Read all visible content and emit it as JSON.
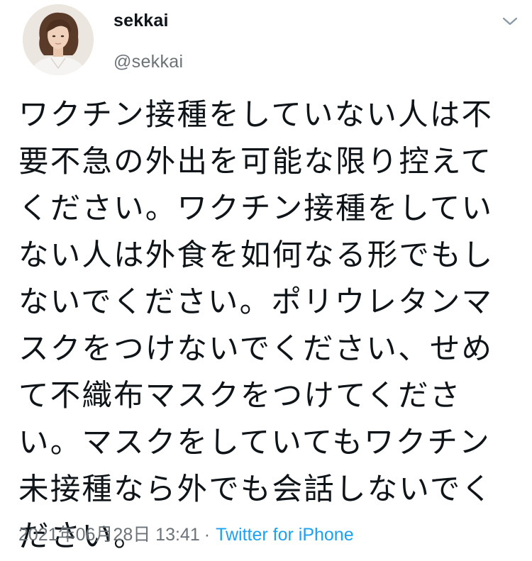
{
  "tweet": {
    "display_name": "sekkai",
    "handle": "@sekkai",
    "text_lines": [
      "ワクチン接種をしていない人は不",
      "要不急の外出を可能な限り控えて",
      "ください。ワクチン接種をしてい",
      "ない人は外食を如何なる形でもし",
      "ないでください。ポリウレタンマ",
      "スクをつけないでください、せめ",
      "て不織布マスクをつけてくださ",
      "い。マスクをしていてもワクチン",
      "未接種なら外でも会話しないでく",
      "ださい。"
    ],
    "timestamp": "2021年06月28日 13:41",
    "separator": "·",
    "source": "Twitter for iPhone"
  },
  "icons": {
    "avatar": "avatar-photo",
    "menu": "chevron-down-icon"
  },
  "colors": {
    "text": "#0f1419",
    "secondary": "#6b7378",
    "link": "#1da1f2"
  }
}
